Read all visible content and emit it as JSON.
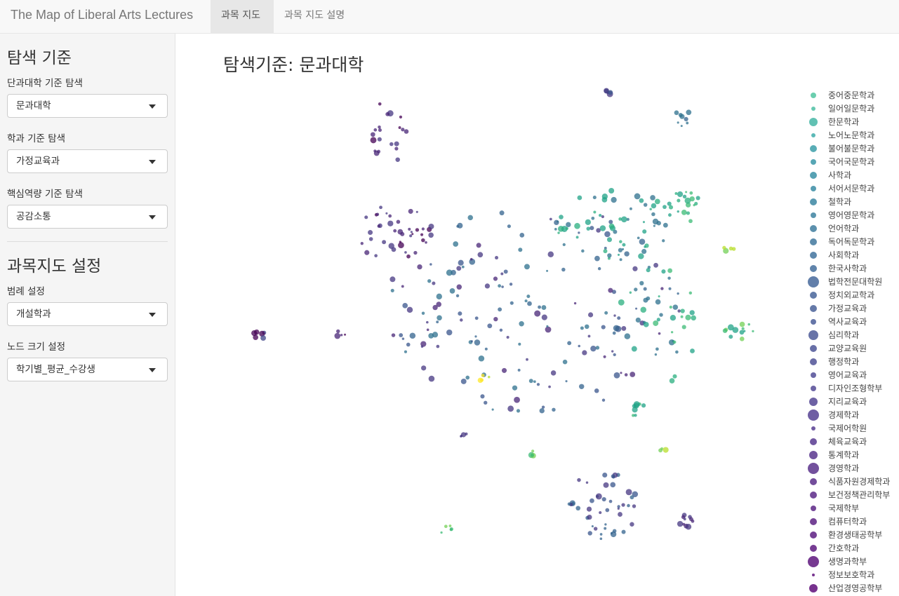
{
  "app": {
    "title": "The Map of Liberal Arts Lectures"
  },
  "tabs": [
    {
      "label": "과목 지도",
      "active": true
    },
    {
      "label": "과목 지도 설명",
      "active": false
    }
  ],
  "sidebar": {
    "section1_title": "탐색 기준",
    "college_label": "단과대학 기준 탐색",
    "college_value": "문과대학",
    "dept_label": "학과 기준 탐색",
    "dept_value": "가정교육과",
    "competency_label": "핵심역량 기준 탐색",
    "competency_value": "공감소통",
    "section2_title": "과목지도 설정",
    "legend_label": "범례 설정",
    "legend_value": "개설학과",
    "size_label": "노드 크기 설정",
    "size_value": "학기별_평균_수강생"
  },
  "plot": {
    "title": "탐색기준: 문과대학"
  },
  "legend": [
    {
      "name": "중어중문학과",
      "color": "#51c5a0",
      "size": 4
    },
    {
      "name": "일어일문학과",
      "color": "#4cbfa3",
      "size": 3
    },
    {
      "name": "한문학과",
      "color": "#45b6a6",
      "size": 6
    },
    {
      "name": "노어노문학과",
      "color": "#3fadaa",
      "size": 3
    },
    {
      "name": "불어불문학과",
      "color": "#3c9fa9",
      "size": 5
    },
    {
      "name": "국어국문학과",
      "color": "#3a96a8",
      "size": 4
    },
    {
      "name": "사학과",
      "color": "#3a91a6",
      "size": 5
    },
    {
      "name": "서어서문학과",
      "color": "#398ca5",
      "size": 4
    },
    {
      "name": "철학과",
      "color": "#3b86a2",
      "size": 5
    },
    {
      "name": "영어영문학과",
      "color": "#3d82a0",
      "size": 4
    },
    {
      "name": "언어학과",
      "color": "#3f7d9f",
      "size": 5
    },
    {
      "name": "독어독문학과",
      "color": "#41789e",
      "size": 5
    },
    {
      "name": "사회학과",
      "color": "#42739d",
      "size": 5
    },
    {
      "name": "한국사학과",
      "color": "#446e9c",
      "size": 5
    },
    {
      "name": "법학전문대학원",
      "color": "#46699b",
      "size": 8
    },
    {
      "name": "정치외교학과",
      "color": "#48659a",
      "size": 5
    },
    {
      "name": "가정교육과",
      "color": "#4a6199",
      "size": 5
    },
    {
      "name": "역사교육과",
      "color": "#4b5e99",
      "size": 4
    },
    {
      "name": "심리학과",
      "color": "#4d5a98",
      "size": 7
    },
    {
      "name": "교양교육원",
      "color": "#4e5698",
      "size": 5
    },
    {
      "name": "행정학과",
      "color": "#505297",
      "size": 5
    },
    {
      "name": "영어교육과",
      "color": "#514e96",
      "size": 4
    },
    {
      "name": "디자인조형학부",
      "color": "#534a95",
      "size": 4
    },
    {
      "name": "지리교육과",
      "color": "#544694",
      "size": 6
    },
    {
      "name": "경제학과",
      "color": "#564293",
      "size": 8
    },
    {
      "name": "국제어학원",
      "color": "#573e92",
      "size": 3
    },
    {
      "name": "체육교육과",
      "color": "#583a90",
      "size": 5
    },
    {
      "name": "통계학과",
      "color": "#59368e",
      "size": 6
    },
    {
      "name": "경영학과",
      "color": "#5a328c",
      "size": 8
    },
    {
      "name": "식품자원경제학과",
      "color": "#5b2e8a",
      "size": 5
    },
    {
      "name": "보건정책관리학부",
      "color": "#5c2a88",
      "size": 5
    },
    {
      "name": "국제학부",
      "color": "#5c2686",
      "size": 4
    },
    {
      "name": "컴퓨터학과",
      "color": "#5d2284",
      "size": 5
    },
    {
      "name": "환경생태공학부",
      "color": "#5d1e82",
      "size": 5
    },
    {
      "name": "간호학과",
      "color": "#5e1a80",
      "size": 5
    },
    {
      "name": "생명과학부",
      "color": "#5e167e",
      "size": 8
    },
    {
      "name": "정보보호학과",
      "color": "#5f127c",
      "size": 2
    },
    {
      "name": "산업경영공학부",
      "color": "#5f0e7a",
      "size": 6
    }
  ]
}
